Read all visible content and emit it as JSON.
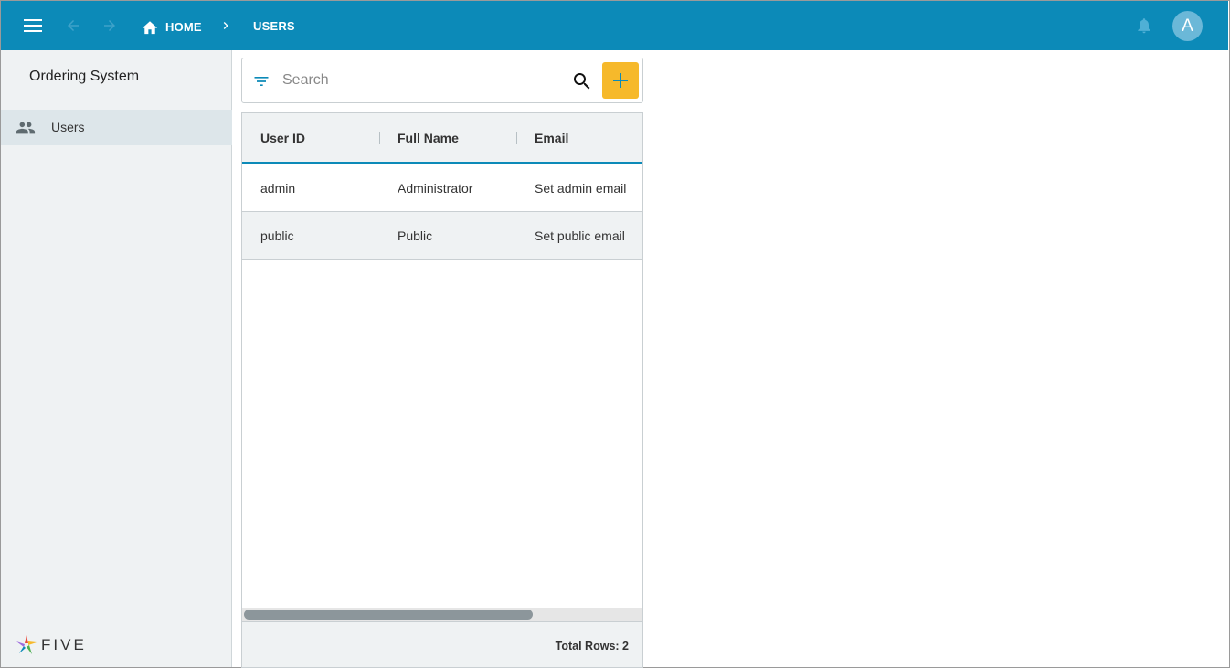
{
  "topbar": {
    "breadcrumb_home": "HOME",
    "breadcrumb_current": "USERS",
    "avatar_initial": "A",
    "color": "#0c8ab8"
  },
  "sidebar": {
    "title": "Ordering System",
    "items": [
      {
        "label": "Users",
        "icon": "people-icon",
        "selected": true
      }
    ],
    "logo_text": "FIVE"
  },
  "search": {
    "placeholder": "Search",
    "value": ""
  },
  "table": {
    "columns": [
      "User ID",
      "Full Name",
      "Email"
    ],
    "rows": [
      [
        "admin",
        "Administrator",
        "Set admin email"
      ],
      [
        "public",
        "Public",
        "Set public email"
      ]
    ],
    "footer": "Total Rows: 2"
  },
  "colors": {
    "accent": "#0c8ab8",
    "add_button": "#f6b92b",
    "sidebar_bg": "#eff2f3"
  }
}
